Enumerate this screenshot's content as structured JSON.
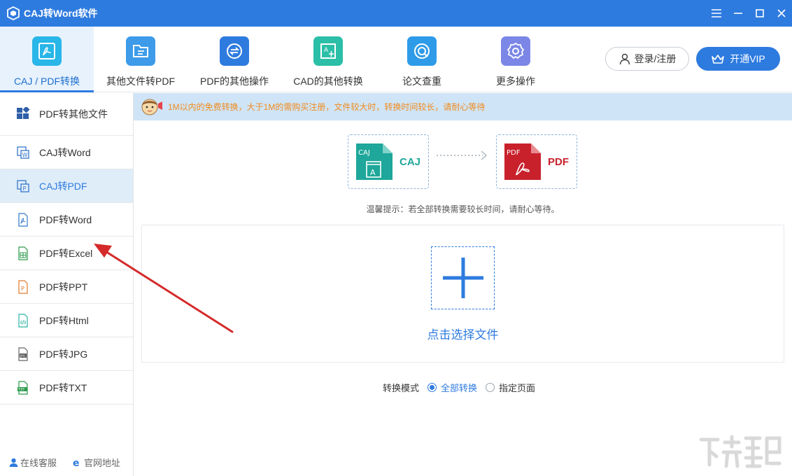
{
  "window": {
    "title": "CAJ转Word软件",
    "controls": [
      "menu",
      "minimize",
      "maximize",
      "close"
    ]
  },
  "toolbar": {
    "tools": [
      {
        "label": "CAJ / PDF转换",
        "icon": "pdf-convert-icon",
        "color": "#29b6e8",
        "active": true
      },
      {
        "label": "其他文件转PDF",
        "icon": "folder-doc-icon",
        "color": "#3d9be9",
        "active": false
      },
      {
        "label": "PDF的其他操作",
        "icon": "swap-icon",
        "color": "#2e7bdf",
        "active": false
      },
      {
        "label": "CAD的其他转换",
        "icon": "cad-icon",
        "color": "#2bbfa7",
        "active": false
      },
      {
        "label": "论文查重",
        "icon": "search-doc-icon",
        "color": "#2e9be8",
        "active": false
      },
      {
        "label": "更多操作",
        "icon": "gear-icon",
        "color": "#7b86e6",
        "active": false
      }
    ],
    "login_label": "登录/注册",
    "vip_label": "开通VIP"
  },
  "sidebar": {
    "header_label": "PDF转其他文件",
    "items": [
      {
        "label": "CAJ转Word",
        "icon": "caj-word-icon",
        "selected": false
      },
      {
        "label": "CAJ转PDF",
        "icon": "caj-pdf-icon",
        "selected": true
      },
      {
        "label": "PDF转Word",
        "icon": "pdf-word-icon",
        "selected": false
      },
      {
        "label": "PDF转Excel",
        "icon": "pdf-excel-icon",
        "selected": false
      },
      {
        "label": "PDF转PPT",
        "icon": "pdf-ppt-icon",
        "selected": false
      },
      {
        "label": "PDF转Html",
        "icon": "pdf-html-icon",
        "selected": false
      },
      {
        "label": "PDF转JPG",
        "icon": "pdf-jpg-icon",
        "selected": false
      },
      {
        "label": "PDF转TXT",
        "icon": "pdf-txt-icon",
        "selected": false
      }
    ],
    "footer": {
      "service_label": "在线客服",
      "website_label": "官网地址"
    }
  },
  "main": {
    "notice": "1M以内的免费转换，大于1M的需购买注册，文件较大时，转换时间较长，请耐心等待",
    "source_format": {
      "badge": "CAJ",
      "label": "CAJ",
      "color": "#1ea79a"
    },
    "target_format": {
      "badge": "PDF",
      "label": "PDF",
      "color": "#c8212c"
    },
    "tip": "温馨提示：若全部转换需要较长时间，请耐心等待。",
    "choose_file_label": "点击选择文件",
    "mode": {
      "label": "转换模式",
      "options": [
        {
          "label": "全部转换",
          "selected": true
        },
        {
          "label": "指定页面",
          "selected": false
        }
      ]
    }
  },
  "colors": {
    "accent": "#2e7bdf",
    "notice_bg": "#cfe4f6",
    "notice_text": "#f08c1e",
    "annotation_arrow": "#d42a2a"
  }
}
